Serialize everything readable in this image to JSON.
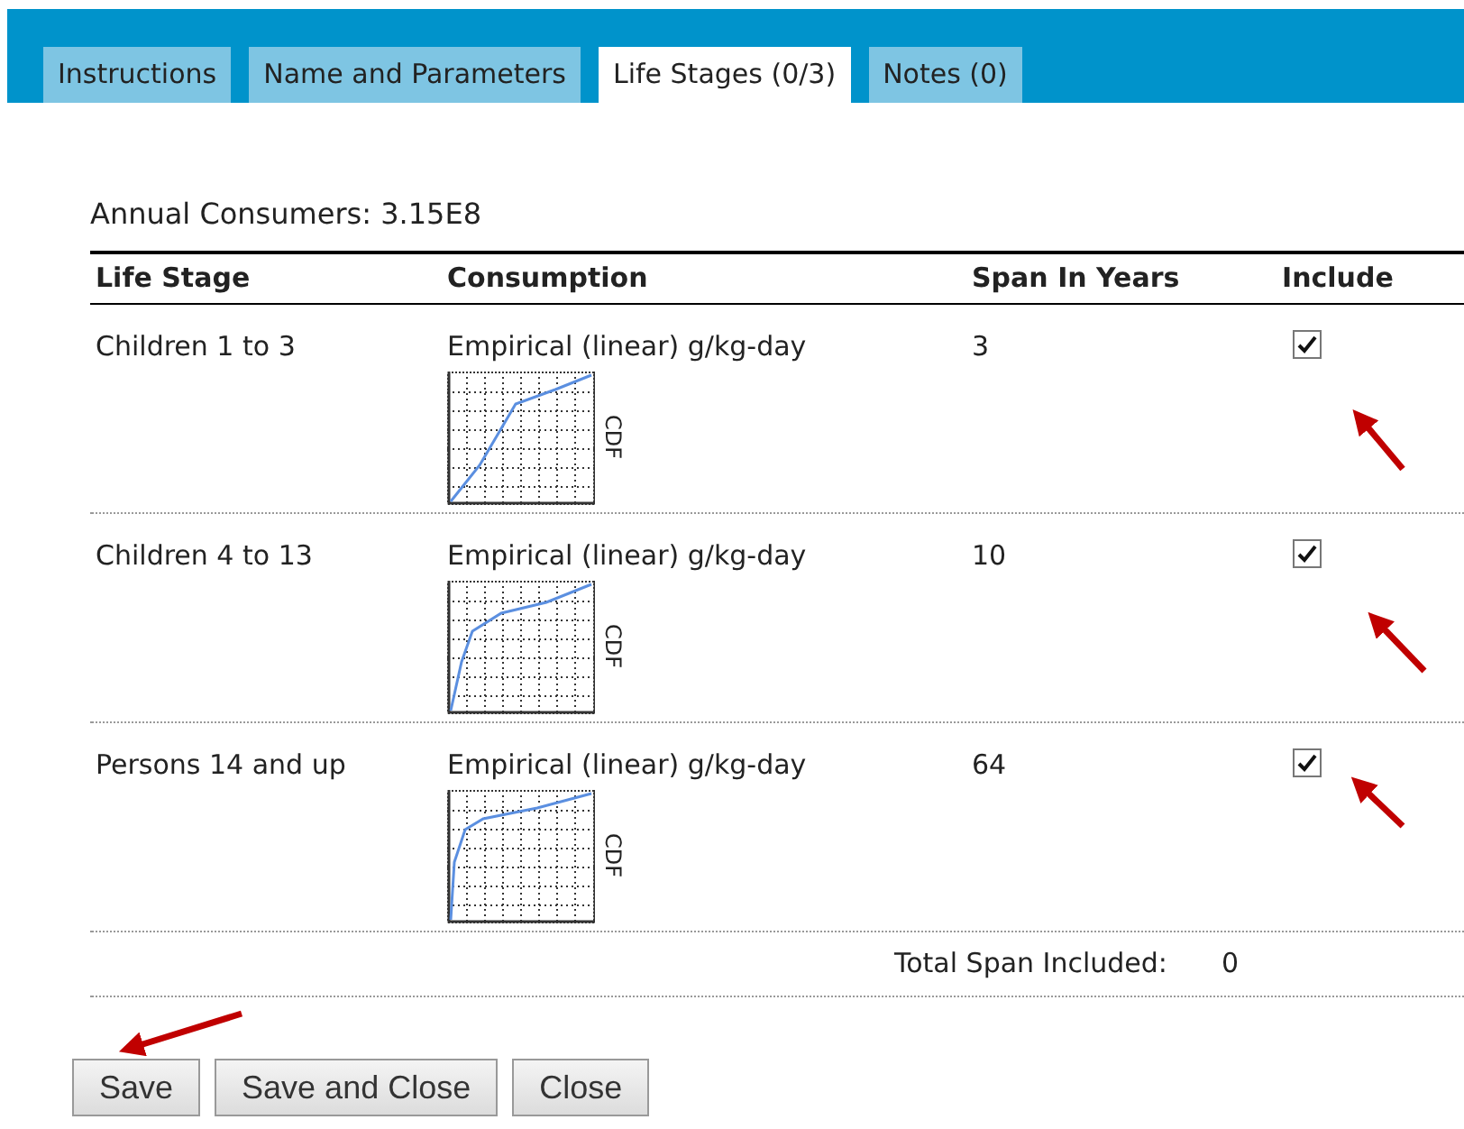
{
  "tabs": [
    {
      "label": "Instructions",
      "selected": false
    },
    {
      "label": "Name and Parameters",
      "selected": false
    },
    {
      "label": "Life Stages (0/3)",
      "selected": true
    },
    {
      "label": "Notes (0)",
      "selected": false
    }
  ],
  "annual_consumers": "Annual Consumers: 3.15E8",
  "table": {
    "columns": [
      "Life Stage",
      "Consumption",
      "Span In Years",
      "Include"
    ],
    "rows": [
      {
        "life_stage": "Children 1 to 3",
        "consumption": "Empirical (linear) g/kg-day",
        "cdf_label": "CDF",
        "span": "3",
        "include": true
      },
      {
        "life_stage": "Children 4 to 13",
        "consumption": "Empirical (linear) g/kg-day",
        "cdf_label": "CDF",
        "span": "10",
        "include": true
      },
      {
        "life_stage": "Persons 14 and up",
        "consumption": "Empirical (linear) g/kg-day",
        "cdf_label": "CDF",
        "span": "64",
        "include": true
      }
    ],
    "total_label": "Total Span Included:",
    "total_value": "0"
  },
  "buttons": [
    "Save",
    "Save and Close",
    "Close"
  ]
}
